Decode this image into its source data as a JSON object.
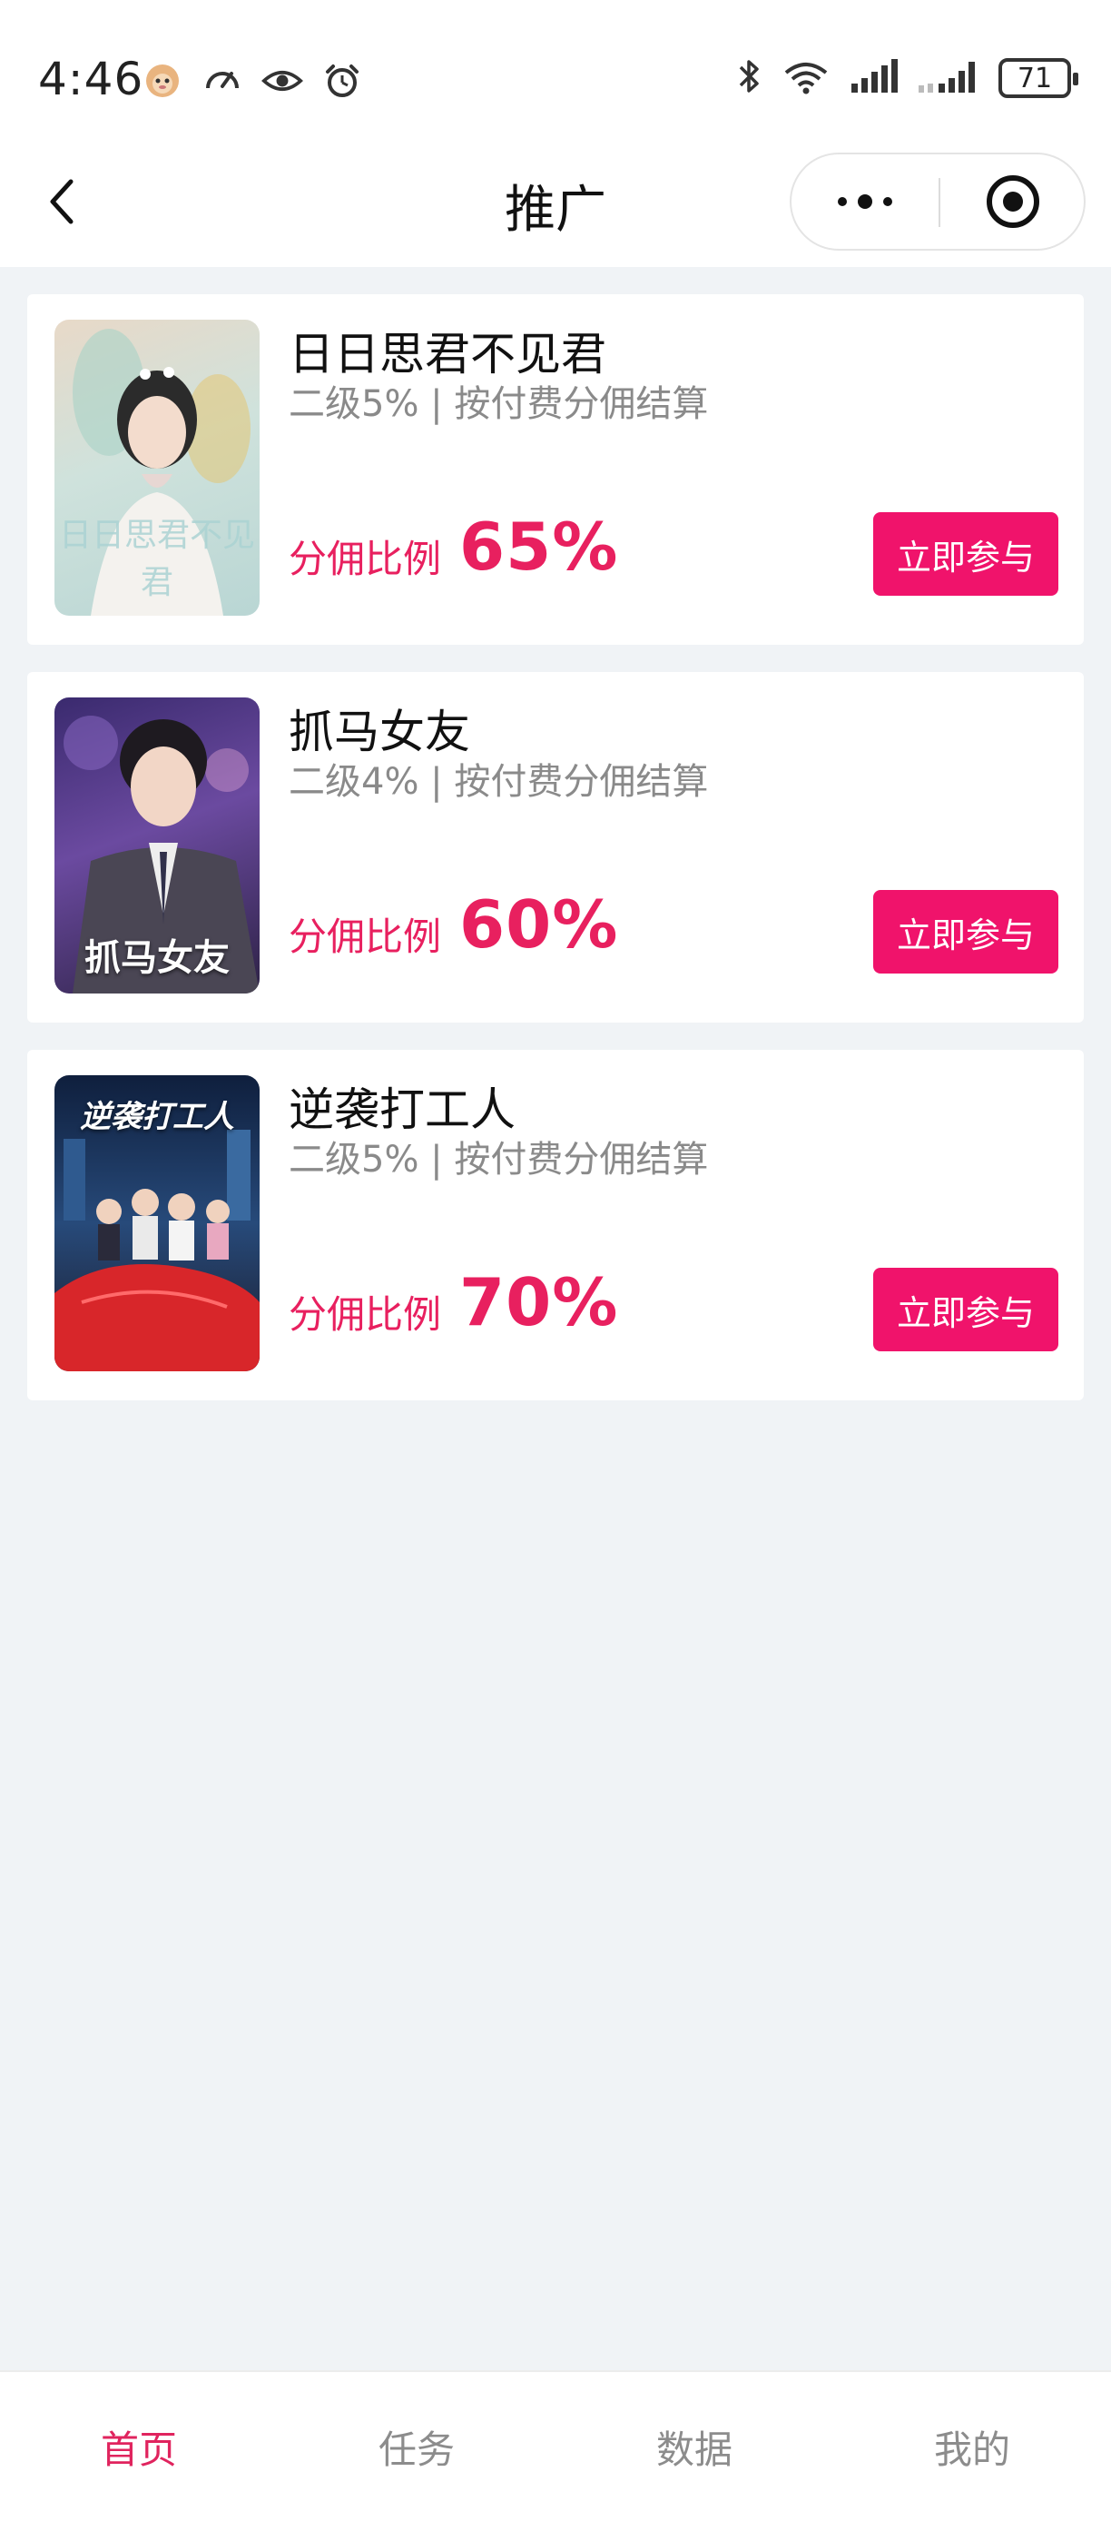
{
  "status_bar": {
    "time": "4:46",
    "left_icons": [
      "monkey-avatar-icon",
      "speed-gauge-icon",
      "eye-icon",
      "alarm-icon"
    ],
    "right_icons": [
      "bluetooth-icon",
      "wifi-6-icon",
      "signal-bars-icon",
      "signal-bars-secondary-icon"
    ],
    "battery": "71"
  },
  "navbar": {
    "title": "推广",
    "back_icon": "chevron-left-icon",
    "more_icon": "more-dots-icon",
    "close_icon": "target-circle-icon"
  },
  "cards": [
    {
      "title": "日日思君不见君",
      "subtitle": "二级5% | 按付费分佣结算",
      "ratio_label": "分佣比例",
      "ratio_value": "65%",
      "button": "立即参与",
      "poster_text": "日日思君不见君"
    },
    {
      "title": "抓马女友",
      "subtitle": "二级4% | 按付费分佣结算",
      "ratio_label": "分佣比例",
      "ratio_value": "60%",
      "button": "立即参与",
      "poster_text": "抓马女友"
    },
    {
      "title": "逆袭打工人",
      "subtitle": "二级5% | 按付费分佣结算",
      "ratio_label": "分佣比例",
      "ratio_value": "70%",
      "button": "立即参与",
      "poster_text": "逆袭打工人"
    }
  ],
  "tabbar": {
    "tabs": [
      {
        "label": "首页",
        "active": true
      },
      {
        "label": "任务",
        "active": false
      },
      {
        "label": "数据",
        "active": false
      },
      {
        "label": "我的",
        "active": false
      }
    ]
  },
  "colors": {
    "accent": "#f0136b",
    "ratio_text": "#e8205f",
    "background": "#f0f3f6"
  }
}
